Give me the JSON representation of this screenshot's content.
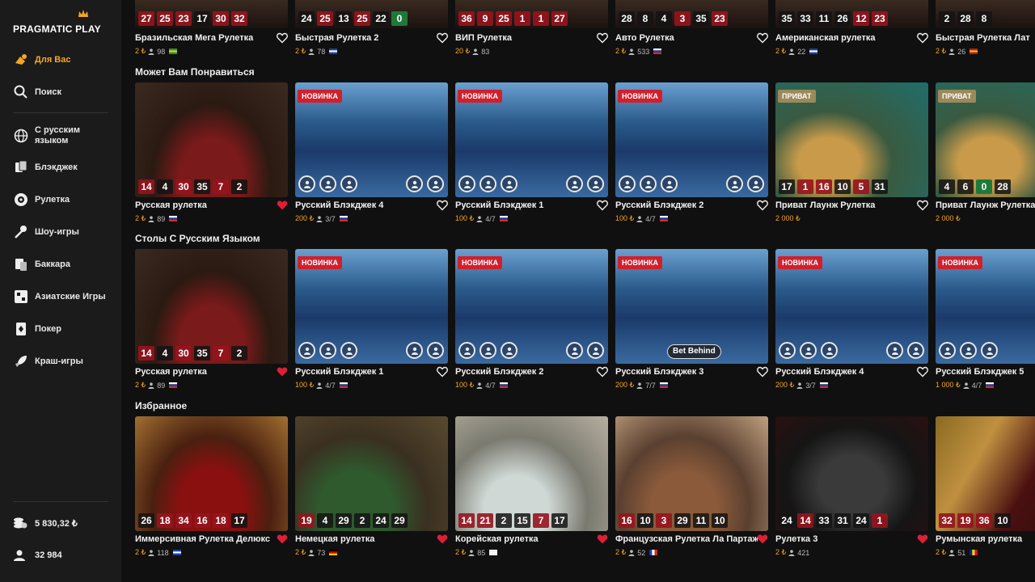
{
  "brand": {
    "logo_text": "PRAGMATIC PLAY",
    "accent": "#f5a623"
  },
  "sidebar": {
    "items": [
      {
        "label": "Для Вас",
        "icon": "for-you-icon",
        "active": true
      },
      {
        "label": "Поиск",
        "icon": "search-icon"
      },
      {
        "label": "С русским языком",
        "icon": "globe-icon"
      },
      {
        "label": "Блэкджек",
        "icon": "blackjack-icon"
      },
      {
        "label": "Рулетка",
        "icon": "roulette-icon"
      },
      {
        "label": "Шоу-игры",
        "icon": "microphone-icon"
      },
      {
        "label": "Баккара",
        "icon": "baccarat-icon"
      },
      {
        "label": "Азиатские Игры",
        "icon": "asian-games-icon"
      },
      {
        "label": "Покер",
        "icon": "poker-icon"
      },
      {
        "label": "Краш-игры",
        "icon": "rocket-icon"
      }
    ],
    "footer": {
      "balance": "5 830,32 ₺",
      "players": "32 984"
    }
  },
  "top_row": {
    "cards": [
      {
        "title": "Бразильская Мега Рулетка",
        "bet": "2 ₺",
        "players": "98",
        "flag": "br",
        "numbers": [
          "27",
          "25",
          "23",
          "17",
          "30",
          "32"
        ]
      },
      {
        "title": "Быстрая Рулетка 2",
        "bet": "2 ₺",
        "players": "78",
        "flag": "gb",
        "numbers": [
          "24",
          "25",
          "13",
          "25",
          "22",
          "0"
        ]
      },
      {
        "title": "ВИП Рулетка",
        "bet": "20 ₺",
        "players": "83",
        "flag": "",
        "numbers": [
          "36",
          "9",
          "25",
          "1",
          "1",
          "27"
        ]
      },
      {
        "title": "Авто Рулетка",
        "bet": "2 ₺",
        "players": "533",
        "flag": "ru",
        "numbers": [
          "28",
          "8",
          "4",
          "3",
          "35",
          "23"
        ]
      },
      {
        "title": "Американская рулетка",
        "bet": "2 ₺",
        "players": "22",
        "flag": "gb",
        "numbers": [
          "35",
          "33",
          "11",
          "26",
          "12",
          "23"
        ]
      },
      {
        "title": "Быстрая Рулетка Лат",
        "bet": "2 ₺",
        "players": "26",
        "flag": "es",
        "numbers": [
          "2",
          "28",
          "8"
        ]
      }
    ]
  },
  "sections": [
    {
      "title": "Может Вам Понравиться",
      "cards": [
        {
          "title": "Русская рулетка",
          "bet": "2 ₺",
          "players": "89",
          "flag": "ru",
          "favorite": true,
          "numbers": [
            "14",
            "4",
            "30",
            "35",
            "7",
            "2"
          ],
          "kind": "roulette"
        },
        {
          "title": "Русский Блэкджек 4",
          "bet": "200 ₺",
          "seats": "3/7",
          "flag": "ru",
          "favorite": false,
          "badge": "НОВИНКА",
          "kind": "blackjack"
        },
        {
          "title": "Русский Блэкджек 1",
          "bet": "100 ₺",
          "seats": "4/7",
          "flag": "ru",
          "favorite": false,
          "badge": "НОВИНКА",
          "kind": "blackjack"
        },
        {
          "title": "Русский Блэкджек 2",
          "bet": "100 ₺",
          "seats": "4/7",
          "flag": "ru",
          "favorite": false,
          "badge": "НОВИНКА",
          "kind": "blackjack"
        },
        {
          "title": "Приват Лаунж Рулетка",
          "bet": "2 000 ₺",
          "flag": "",
          "favorite": false,
          "badge": "ПРИВАТ",
          "numbers": [
            "17",
            "1",
            "16",
            "10",
            "5",
            "31"
          ],
          "kind": "roulette-green"
        },
        {
          "title": "Приват Лаунж Рулетка",
          "bet": "2 000 ₺",
          "flag": "",
          "favorite": false,
          "badge": "ПРИВАТ",
          "numbers": [
            "4",
            "6",
            "0",
            "28"
          ],
          "kind": "roulette-green"
        }
      ]
    },
    {
      "title": "Столы С Русским Языком",
      "cards": [
        {
          "title": "Русская рулетка",
          "bet": "2 ₺",
          "players": "89",
          "flag": "ru",
          "favorite": true,
          "numbers": [
            "14",
            "4",
            "30",
            "35",
            "7",
            "2"
          ],
          "kind": "roulette"
        },
        {
          "title": "Русский Блэкджек 1",
          "bet": "100 ₺",
          "seats": "4/7",
          "flag": "ru",
          "favorite": false,
          "badge": "НОВИНКА",
          "kind": "blackjack"
        },
        {
          "title": "Русский Блэкджек 2",
          "bet": "100 ₺",
          "seats": "4/7",
          "flag": "ru",
          "favorite": false,
          "badge": "НОВИНКА",
          "kind": "blackjack"
        },
        {
          "title": "Русский Блэкджек 3",
          "bet": "200 ₺",
          "seats": "7/7",
          "flag": "ru",
          "favorite": false,
          "badge": "НОВИНКА",
          "kind": "blackjack",
          "bet_behind": "Bet Behind"
        },
        {
          "title": "Русский Блэкджек 4",
          "bet": "200 ₺",
          "seats": "3/7",
          "flag": "ru",
          "favorite": false,
          "badge": "НОВИНКА",
          "kind": "blackjack"
        },
        {
          "title": "Русский Блэкджек 5",
          "bet": "1 000 ₺",
          "seats": "4/7",
          "flag": "ru",
          "favorite": false,
          "badge": "НОВИНКА",
          "kind": "blackjack"
        }
      ]
    },
    {
      "title": "Избранное",
      "cards": [
        {
          "title": "Иммерсивная Рулетка Делюкс",
          "bet": "2 ₺",
          "players": "118",
          "flag": "gb",
          "favorite": true,
          "numbers": [
            "26",
            "18",
            "34",
            "16",
            "18",
            "17"
          ],
          "kind": "roulette-red"
        },
        {
          "title": "Немецкая рулетка",
          "bet": "2 ₺",
          "players": "73",
          "flag": "de",
          "favorite": true,
          "numbers": [
            "19",
            "4",
            "29",
            "2",
            "24",
            "29"
          ],
          "kind": "roulette-greenhall"
        },
        {
          "title": "Корейская рулетка",
          "bet": "2 ₺",
          "players": "85",
          "flag": "kr",
          "favorite": true,
          "numbers": [
            "14",
            "21",
            "2",
            "15",
            "7",
            "17"
          ],
          "kind": "roulette-white"
        },
        {
          "title": "Французская Рулетка Ла Партаж",
          "bet": "2 ₺",
          "players": "52",
          "flag": "fr",
          "favorite": true,
          "numbers": [
            "16",
            "10",
            "3",
            "29",
            "11",
            "10"
          ],
          "kind": "roulette-brown"
        },
        {
          "title": "Рулетка 3",
          "bet": "2 ₺",
          "players": "421",
          "flag": "",
          "favorite": true,
          "numbers": [
            "24",
            "14",
            "33",
            "31",
            "24",
            "1"
          ],
          "kind": "roulette-dark"
        },
        {
          "title": "Румынская рулетка",
          "bet": "2 ₺",
          "players": "51",
          "flag": "ro",
          "favorite": false,
          "numbers": [
            "32",
            "19",
            "36",
            "10"
          ],
          "kind": "roulette-gold"
        }
      ]
    }
  ],
  "red_numbers": [
    "1",
    "3",
    "5",
    "7",
    "9",
    "12",
    "14",
    "16",
    "18",
    "19",
    "21",
    "23",
    "25",
    "27",
    "30",
    "32",
    "34",
    "36"
  ]
}
